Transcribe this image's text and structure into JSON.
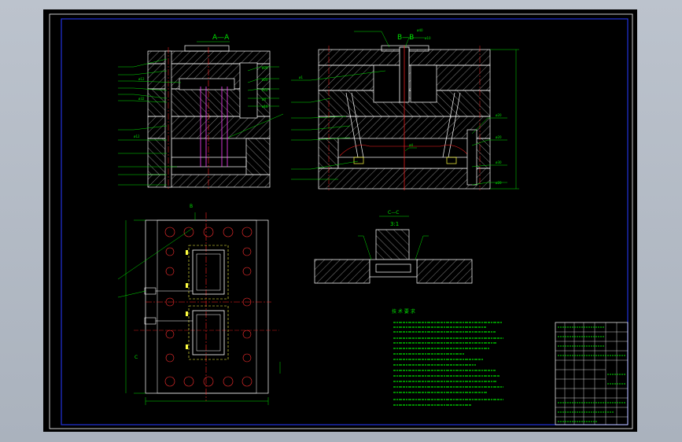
{
  "views": {
    "section_aa": {
      "title": "A—A"
    },
    "section_bb": {
      "title": "B—B"
    },
    "detail_cc": {
      "title": "C—C",
      "scale": "3:1"
    },
    "plan": {
      "marker_b": "B",
      "marker_c": "C"
    }
  },
  "tech_notes": {
    "heading": "技 术 要 求"
  },
  "colors": {
    "paper": "#000000",
    "workspace": "#b7bec8",
    "outline": "#ffffff",
    "frame": "#1a2bd6",
    "leader": "#00e000",
    "center": "#ff2020",
    "hidden": "#ffff40",
    "slider": "#ff40ff",
    "hatch": "#c8c8c8"
  }
}
